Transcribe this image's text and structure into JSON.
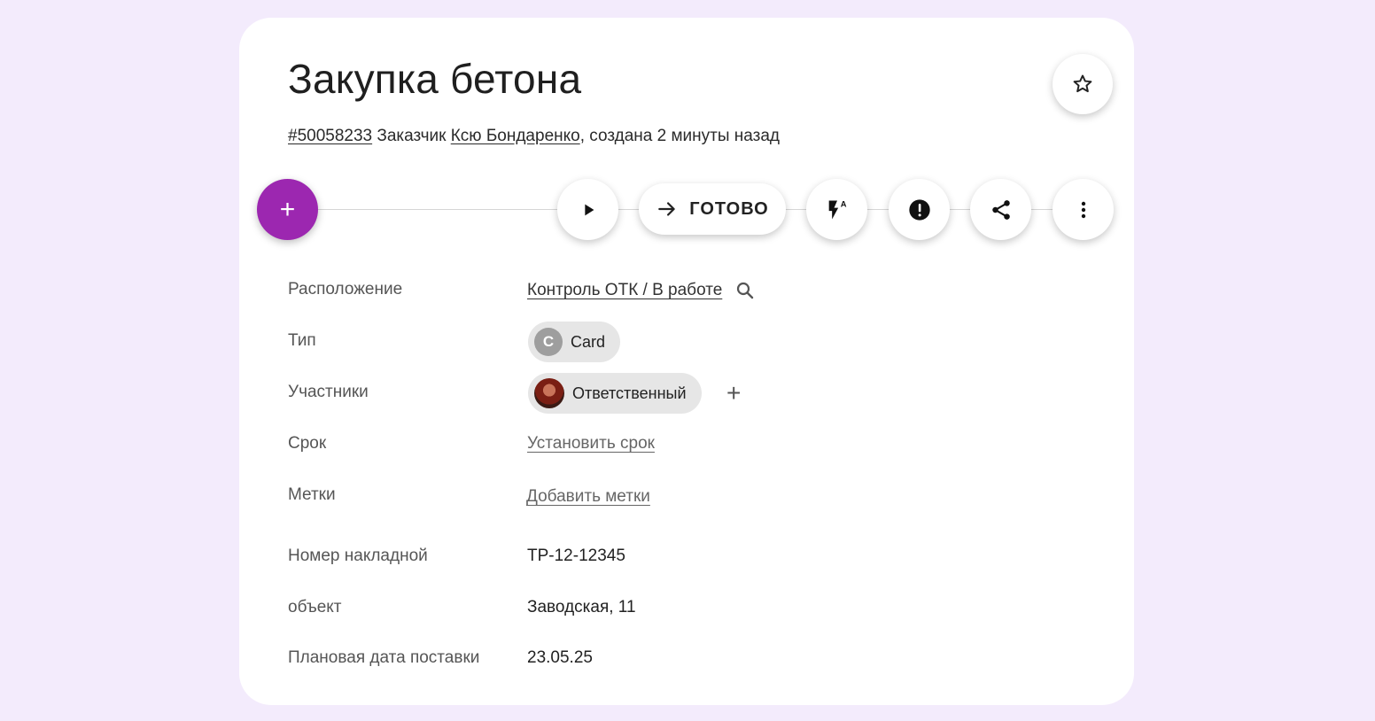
{
  "task": {
    "title": "Закупка бетона",
    "id_text": "#50058233",
    "customer_prefix": "Заказчик",
    "customer_name": "Ксю Бондаренко",
    "created_text": ", создана 2 минуты назад"
  },
  "toolbar": {
    "add_symbol": "+",
    "done_label": "ГОТОВО"
  },
  "fields": {
    "location": {
      "label": "Расположение",
      "value": "Контроль ОТК / В работе"
    },
    "type": {
      "label": "Тип",
      "chip_letter": "C",
      "value": "Card"
    },
    "participants": {
      "label": "Участники",
      "chip_label": "Ответственный",
      "add_symbol": "+"
    },
    "deadline": {
      "label": "Срок",
      "action": "Установить срок"
    },
    "tags": {
      "label": "Метки",
      "action": "Добавить метки"
    },
    "invoice": {
      "label": "Номер накладной",
      "value": "ТР-12-12345"
    },
    "object": {
      "label": "объект",
      "value": "Заводская, 11"
    },
    "delivery": {
      "label": "Плановая дата поставки",
      "value": "23.05.25"
    }
  },
  "icons": {
    "star": "star-outline-icon",
    "play": "play-icon",
    "arrow": "arrow-right-icon",
    "automation": "flash-auto-icon",
    "alert": "alert-circle-icon",
    "share": "share-icon",
    "more": "more-vert-icon",
    "search": "search-icon"
  },
  "colors": {
    "background": "#f3ebfc",
    "accent": "#9c27b0",
    "card": "#ffffff",
    "chip": "#e6e6e6"
  }
}
